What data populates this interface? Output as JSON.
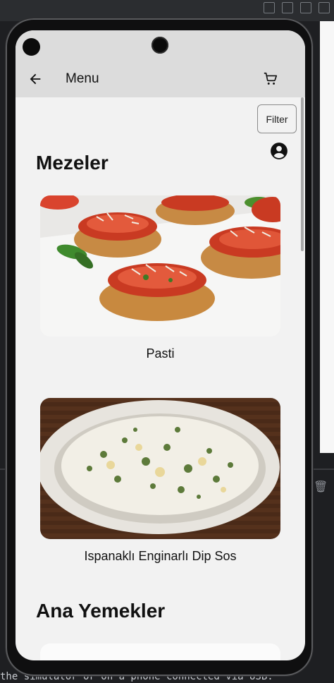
{
  "appbar": {
    "title": "Menu",
    "back_icon": "arrow-left-icon",
    "cart_icon": "shopping-cart-icon"
  },
  "toolbar": {
    "filter_label": "Filter",
    "profile_icon": "account-circle-icon"
  },
  "sections": [
    {
      "title": "Mezeler",
      "items": [
        {
          "name": "Pasti",
          "image": "bruschetta-photo"
        },
        {
          "name": "Ispanaklı Enginarlı Dip Sos",
          "image": "spinach-artichoke-dip-photo"
        }
      ]
    },
    {
      "title": "Ana Yemekler",
      "items": []
    }
  ],
  "console": {
    "text": "the simulator or on a phone connected via USB."
  }
}
